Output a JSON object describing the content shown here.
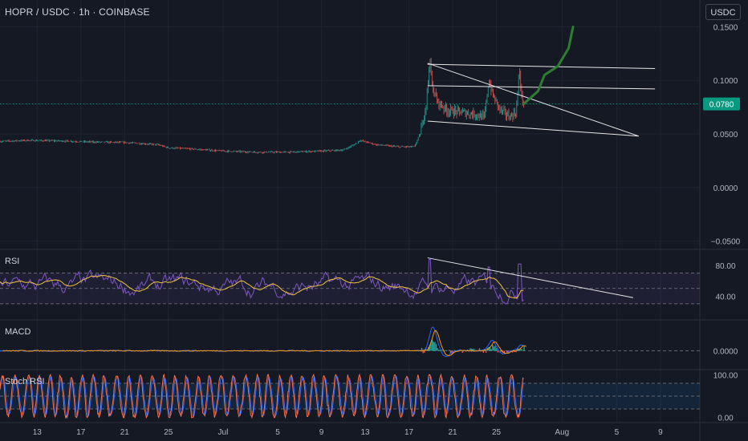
{
  "header": {
    "title": "HOPR / USDC · 1h · COINBASE",
    "currency_button": "USDC"
  },
  "colors": {
    "background": "#151924",
    "grid": "#1f2330",
    "candle_up": "#26a69a",
    "candle_down": "#ef5350",
    "current_price": "#089981",
    "rsi_line": "#7e57c2",
    "rsi_ma": "#f0c33c",
    "macd_line": "#ff9800",
    "stoch_k": "#ff7043",
    "stoch_d": "#2962ff",
    "projection": "#2e7d32",
    "trendline": "#e6e6e6"
  },
  "chart_data": [
    {
      "type": "candlestick",
      "pane": "price",
      "symbol": "HOPR / USDC",
      "interval": "1h",
      "exchange": "COINBASE",
      "y_ticks": [
        "0.1500",
        "0.1000",
        "0.0500",
        "0.0000",
        "−0.0500"
      ],
      "y_tick_values": [
        0.15,
        0.1,
        0.05,
        0.0,
        -0.05
      ],
      "ylim": [
        -0.057,
        0.175
      ],
      "current_price": 0.078,
      "current_price_label": "0.0780",
      "x_ticks": [
        "13",
        "17",
        "21",
        "25",
        "Jul",
        "5",
        "9",
        "13",
        "17",
        "21",
        "25",
        "Aug",
        "5",
        "9"
      ],
      "x_tick_days": [
        13,
        17,
        21,
        25,
        30,
        35,
        39,
        43,
        47,
        51,
        55,
        61,
        66,
        70
      ],
      "xlim": [
        9.6,
        73.6
      ],
      "data_end_day": 57.5,
      "price_path": [
        [
          9.6,
          0.043
        ],
        [
          12,
          0.044
        ],
        [
          15,
          0.0435
        ],
        [
          18,
          0.0425
        ],
        [
          21,
          0.042
        ],
        [
          24,
          0.04
        ],
        [
          25,
          0.037
        ],
        [
          27,
          0.036
        ],
        [
          30,
          0.034
        ],
        [
          33,
          0.033
        ],
        [
          36,
          0.033
        ],
        [
          39,
          0.034
        ],
        [
          41,
          0.035
        ],
        [
          42,
          0.04
        ],
        [
          42.5,
          0.044
        ],
        [
          44,
          0.04
        ],
        [
          46,
          0.038
        ],
        [
          47.5,
          0.038
        ],
        [
          48,
          0.05
        ],
        [
          48.2,
          0.058
        ],
        [
          48.6,
          0.08
        ],
        [
          48.9,
          0.12
        ],
        [
          49.1,
          0.095
        ],
        [
          49.6,
          0.08
        ],
        [
          50.5,
          0.072
        ],
        [
          52,
          0.07
        ],
        [
          53.2,
          0.068
        ],
        [
          53.9,
          0.065
        ],
        [
          54.3,
          0.1
        ],
        [
          54.7,
          0.085
        ],
        [
          55.4,
          0.072
        ],
        [
          56.2,
          0.066
        ],
        [
          56.8,
          0.07
        ],
        [
          57.1,
          0.11
        ],
        [
          57.3,
          0.085
        ],
        [
          57.5,
          0.078
        ]
      ],
      "trendlines": [
        {
          "from": [
            48.7,
            0.115
          ],
          "to": [
            69.5,
            0.111
          ]
        },
        {
          "from": [
            48.7,
            0.095
          ],
          "to": [
            69.5,
            0.092
          ]
        },
        {
          "from": [
            48.7,
            0.116
          ],
          "to": [
            68.0,
            0.048
          ]
        },
        {
          "from": [
            48.7,
            0.062
          ],
          "to": [
            68.0,
            0.048
          ]
        }
      ],
      "projection_path": [
        [
          57.5,
          0.078
        ],
        [
          58.8,
          0.09
        ],
        [
          59.4,
          0.105
        ],
        [
          60.6,
          0.113
        ],
        [
          61.6,
          0.13
        ],
        [
          62.0,
          0.15
        ]
      ]
    },
    {
      "type": "line",
      "pane": "rsi",
      "title": "RSI",
      "y_ticks": [
        "80.00",
        "40.00"
      ],
      "y_tick_values": [
        80,
        40
      ],
      "ylim": [
        10,
        100
      ],
      "band": [
        30,
        70
      ],
      "mid": 50,
      "typical_range": [
        35,
        70
      ],
      "peak_values": [
        [
          48.9,
          88
        ],
        [
          54.3,
          78
        ],
        [
          57.1,
          82
        ]
      ],
      "trendline": {
        "from": [
          48.7,
          90
        ],
        "to": [
          67.5,
          38
        ]
      }
    },
    {
      "type": "line",
      "pane": "macd",
      "title": "MACD",
      "y_ticks": [
        "0.0000"
      ],
      "y_tick_values": [
        0
      ],
      "ylim": [
        -0.012,
        0.02
      ],
      "peaks": [
        [
          49.2,
          0.016
        ],
        [
          54.6,
          0.007
        ],
        [
          57.3,
          0.004
        ]
      ],
      "troughs": [
        [
          50.4,
          -0.004
        ],
        [
          55.6,
          -0.002
        ]
      ]
    },
    {
      "type": "line",
      "pane": "stoch_rsi",
      "title": "Stoch RSI",
      "y_ticks": [
        "100.00",
        "0.00"
      ],
      "y_tick_values": [
        100,
        0
      ],
      "ylim": [
        -10,
        110
      ],
      "band": [
        20,
        80
      ]
    }
  ]
}
